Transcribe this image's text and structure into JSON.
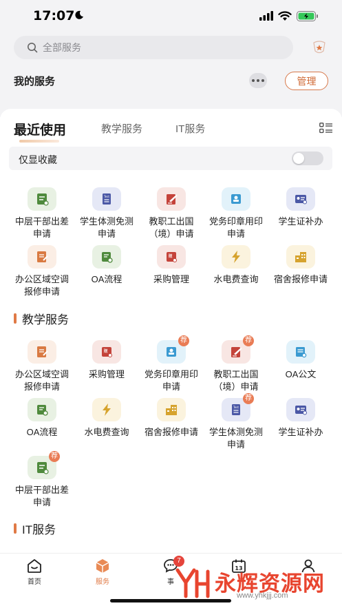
{
  "status_bar": {
    "time": "17:07"
  },
  "search": {
    "placeholder": "全部服务"
  },
  "my_services": {
    "title": "我的服务",
    "manage_label": "管理"
  },
  "tabs": [
    {
      "label": "最近使用",
      "active": true
    },
    {
      "label": "教学服务",
      "active": false
    },
    {
      "label": "IT服务",
      "active": false
    }
  ],
  "favorites_only": {
    "label": "仅显收藏",
    "on": false
  },
  "recent": [
    {
      "label": "中层干部出差申请",
      "icon": "travel-form-icon",
      "color": "#4f8a3d",
      "bg": "#e8f1e3"
    },
    {
      "label": "学生体测免测申请",
      "icon": "document-icon",
      "color": "#4b58a6",
      "bg": "#e5e8f6"
    },
    {
      "label": "教职工出国（境）申请",
      "icon": "airplane-doc-icon",
      "color": "#c4433a",
      "bg": "#f8e6e3"
    },
    {
      "label": "党务印章用印申请",
      "icon": "stamp-icon",
      "color": "#3a9ad1",
      "bg": "#e2f2fa"
    },
    {
      "label": "学生证补办",
      "icon": "id-card-icon",
      "color": "#4b58a6",
      "bg": "#e5e8f6"
    },
    {
      "label": "办公区域空调报修申请",
      "icon": "repair-form-icon",
      "color": "#d97a42",
      "bg": "#fbeee5"
    },
    {
      "label": "OA流程",
      "icon": "oa-flow-icon",
      "color": "#4f8a3d",
      "bg": "#e8f1e3"
    },
    {
      "label": "采购管理",
      "icon": "purchase-icon",
      "color": "#c4433a",
      "bg": "#f8e6e3"
    },
    {
      "label": "水电费查询",
      "icon": "lightning-icon",
      "color": "#d6a32e",
      "bg": "#fbf3de"
    },
    {
      "label": "宿舍报修申请",
      "icon": "building-icon",
      "color": "#d6a32e",
      "bg": "#fbf3de"
    }
  ],
  "teaching": {
    "title": "教学服务",
    "items": [
      {
        "label": "办公区域空调报修申请",
        "icon": "repair-form-icon",
        "color": "#d97a42",
        "bg": "#fbeee5",
        "recommended": false
      },
      {
        "label": "采购管理",
        "icon": "purchase-icon",
        "color": "#c4433a",
        "bg": "#f8e6e3",
        "recommended": false
      },
      {
        "label": "党务印章用印申请",
        "icon": "stamp-icon",
        "color": "#3a9ad1",
        "bg": "#e2f2fa",
        "recommended": true
      },
      {
        "label": "教职工出国（境）申请",
        "icon": "airplane-doc-icon",
        "color": "#c4433a",
        "bg": "#f8e6e3",
        "recommended": true
      },
      {
        "label": "OA公文",
        "icon": "document-search-icon",
        "color": "#3a9ad1",
        "bg": "#e2f2fa",
        "recommended": false
      },
      {
        "label": "OA流程",
        "icon": "oa-flow-icon",
        "color": "#4f8a3d",
        "bg": "#e8f1e3",
        "recommended": false
      },
      {
        "label": "水电费查询",
        "icon": "lightning-icon",
        "color": "#d6a32e",
        "bg": "#fbf3de",
        "recommended": false
      },
      {
        "label": "宿舍报修申请",
        "icon": "building-icon",
        "color": "#d6a32e",
        "bg": "#fbf3de",
        "recommended": false
      },
      {
        "label": "学生体测免测申请",
        "icon": "document-icon",
        "color": "#4b58a6",
        "bg": "#e5e8f6",
        "recommended": true
      },
      {
        "label": "学生证补办",
        "icon": "id-card-icon",
        "color": "#4b58a6",
        "bg": "#e5e8f6",
        "recommended": false
      },
      {
        "label": "中层干部出差申请",
        "icon": "travel-form-icon",
        "color": "#4f8a3d",
        "bg": "#e8f1e3",
        "recommended": true
      }
    ]
  },
  "recommend_badge": "荐",
  "it": {
    "title": "IT服务"
  },
  "bottom_nav": [
    {
      "label": "首页",
      "icon": "home-icon",
      "active": false
    },
    {
      "label": "服务",
      "icon": "cube-icon",
      "active": true
    },
    {
      "label": "事",
      "icon": "chat-icon",
      "active": false,
      "badge": "7"
    },
    {
      "label": "",
      "icon": "calendar-icon",
      "active": false
    },
    {
      "label": "",
      "icon": "person-icon",
      "active": false
    }
  ],
  "watermark": {
    "text": "永辉资源网",
    "url": "www.yhkjjj.com"
  },
  "colors": {
    "accent": "#e07a46",
    "manage_border": "#d7784a",
    "badge_red": "#e5443b"
  }
}
